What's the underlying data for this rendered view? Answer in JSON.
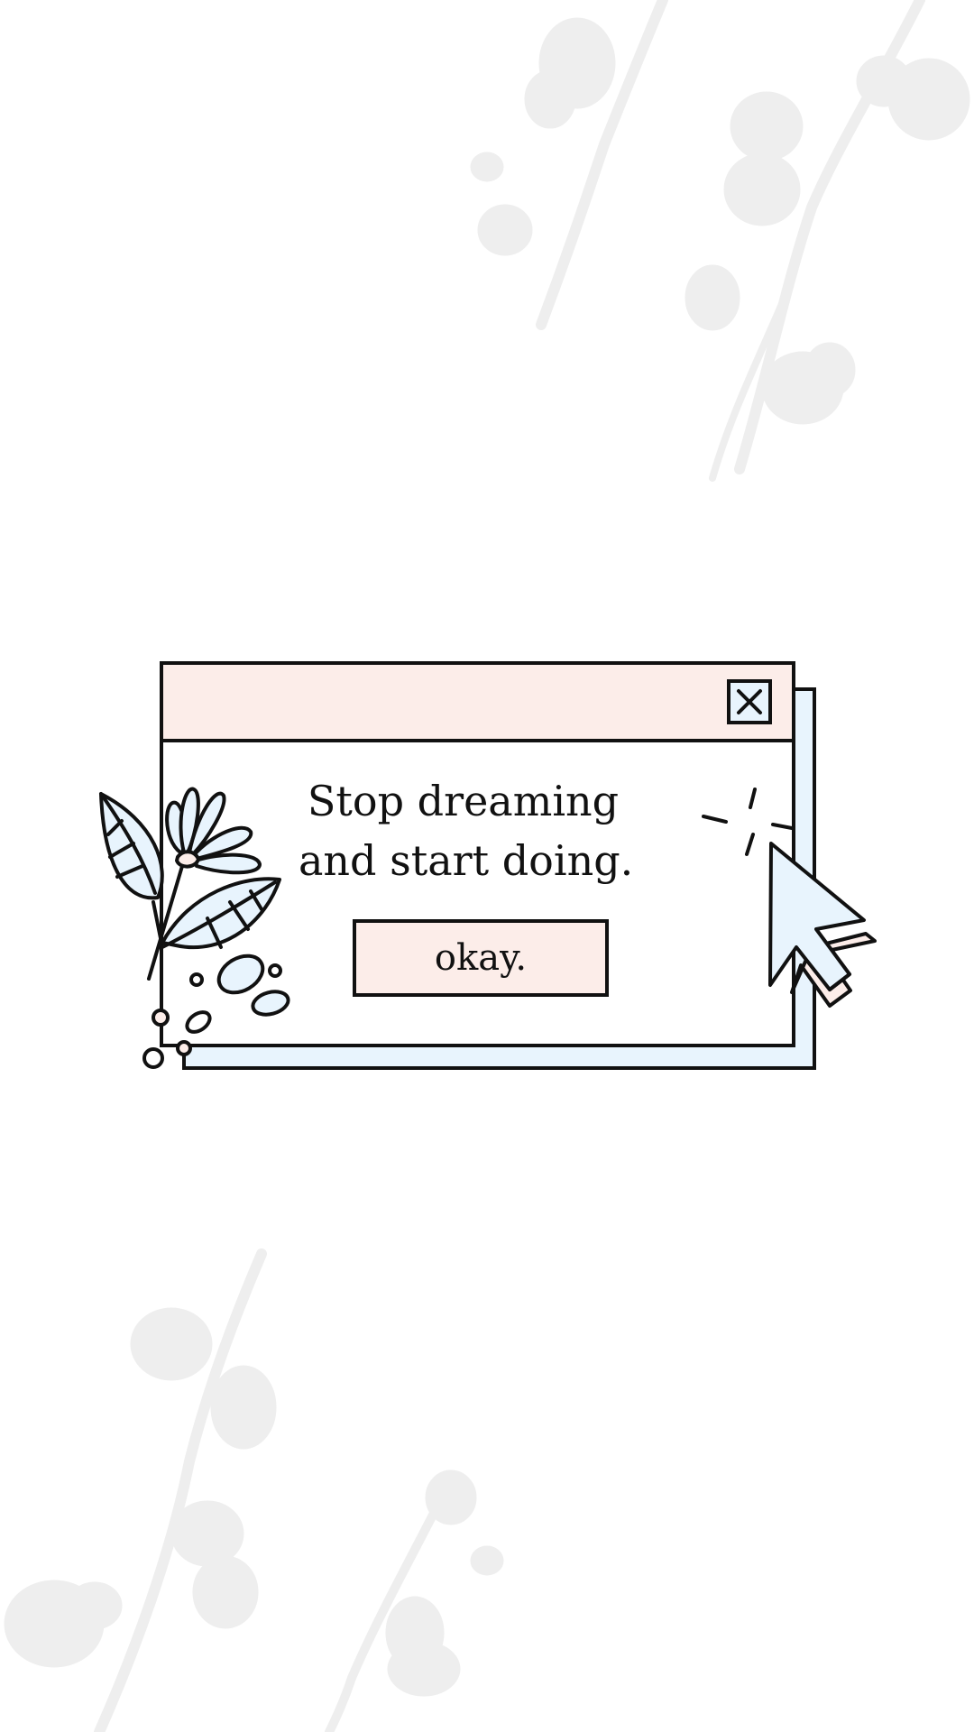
{
  "dialog": {
    "message_line1": "Stop dreaming",
    "message_line2": "and start doing.",
    "ok_label": "okay."
  },
  "icons": {
    "close": "close-x-icon",
    "cursor": "mouse-pointer-icon",
    "flower": "flower-leaves-illustration",
    "background": "blossom-branch-shadow"
  },
  "colors": {
    "titlebar": "#fcede9",
    "accent_blue": "#e8f4fd",
    "outline": "#111111",
    "background_shadow": "#eeeeee"
  }
}
